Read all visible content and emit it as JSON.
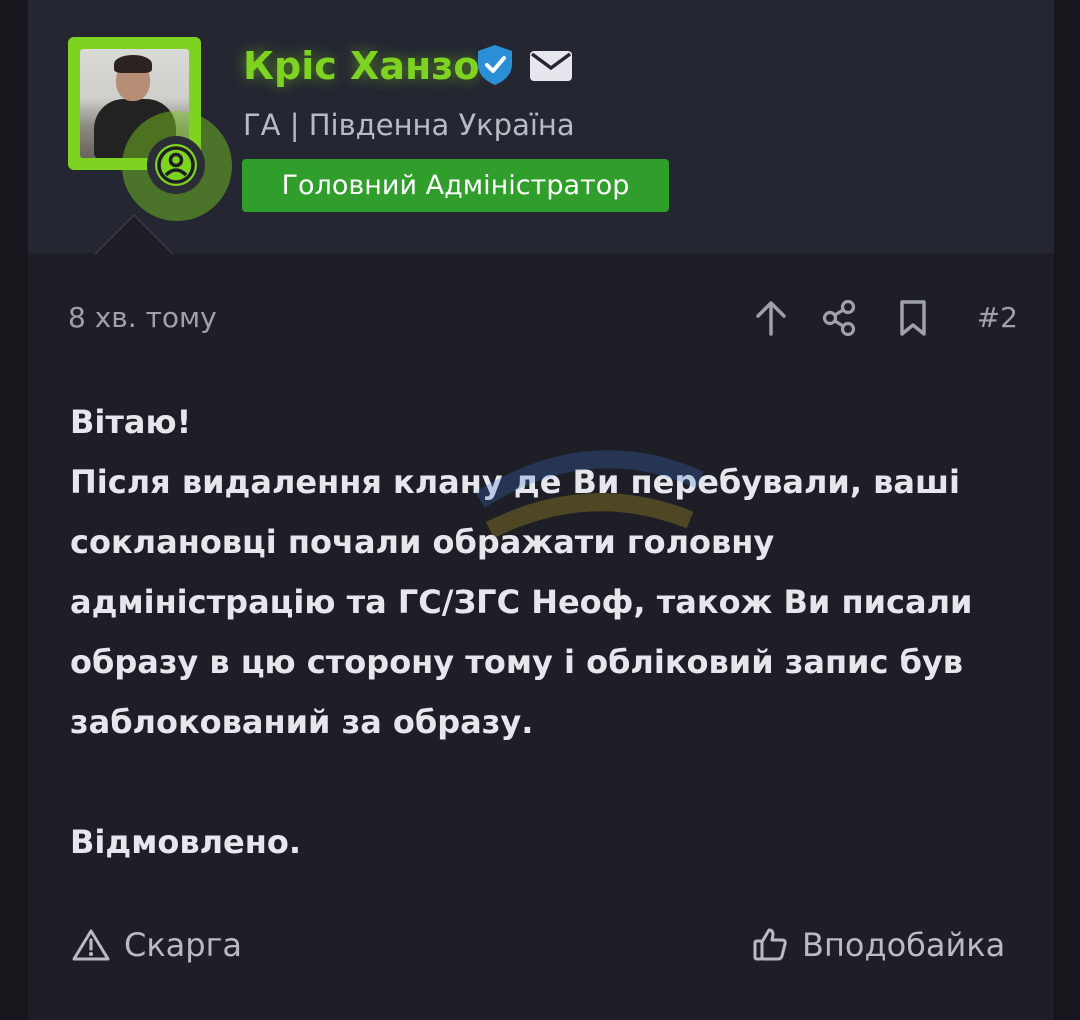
{
  "author": {
    "name": "Кріс Ханзо",
    "subtitle": "ГА | Південна Україна",
    "role": "Головний Адміністратор",
    "name_color": "#7ed321",
    "role_color": "#2f9e2a",
    "verified_icon": "verified-shield-icon",
    "message_icon": "envelope-icon",
    "status_icon": "user-circle-icon"
  },
  "post": {
    "time": "8 хв. тому",
    "number": "#2",
    "actions": [
      "arrow-up-icon",
      "share-icon",
      "bookmark-icon"
    ],
    "greeting": "Вітаю!",
    "body": "Після видалення клану де Ви перебували, ваші соклановці почали ображати головну адміністрацію та ГС/ЗГС Неоф, також Ви писали образу в цю сторону тому і обліковий запис був заблокований за образу.",
    "verdict": "Відмовлено."
  },
  "footer": {
    "report_label": "Скарга",
    "like_label": "Вподобайка"
  }
}
